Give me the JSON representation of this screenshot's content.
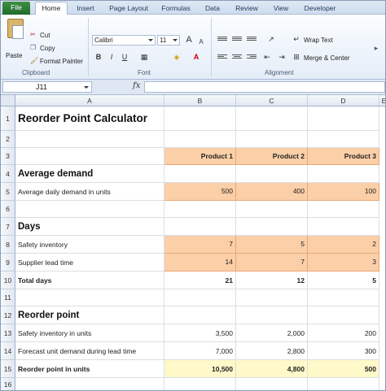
{
  "ribbon": {
    "tabs": [
      "File",
      "Home",
      "Insert",
      "Page Layout",
      "Formulas",
      "Data",
      "Review",
      "View",
      "Developer"
    ],
    "clipboard": {
      "paste": "Paste",
      "cut": "Cut",
      "copy": "Copy",
      "format_painter": "Format Painter",
      "label": "Clipboard"
    },
    "font": {
      "family": "Calibri",
      "size": "11",
      "bold": "B",
      "italic": "I",
      "underline": "U",
      "grow": "A",
      "shrink": "A",
      "label": "Font"
    },
    "alignment": {
      "wrap_text": "Wrap Text",
      "merge_center": "Merge & Center",
      "label": "Alignment"
    }
  },
  "formula_bar": {
    "name_box": "J11",
    "fx": "fx",
    "formula": ""
  },
  "columns": [
    "A",
    "B",
    "C",
    "D",
    "E"
  ],
  "rows": [
    "1",
    "2",
    "3",
    "4",
    "5",
    "6",
    "7",
    "8",
    "9",
    "10",
    "11",
    "12",
    "13",
    "14",
    "15",
    "16"
  ],
  "sheet": {
    "title": "Reorder Point Calculator",
    "headers": [
      "Product 1",
      "Product 2",
      "Product 3"
    ],
    "average_demand_heading": "Average demand",
    "avg_daily_demand": {
      "label": "Average daily demand in units",
      "values": [
        "500",
        "400",
        "100"
      ]
    },
    "days_heading": "Days",
    "safety_inventory": {
      "label": "Safety inventory",
      "values": [
        "7",
        "5",
        "2"
      ]
    },
    "supplier_lead_time": {
      "label": "Supplier lead time",
      "values": [
        "14",
        "7",
        "3"
      ]
    },
    "total_days": {
      "label": "Total days",
      "values": [
        "21",
        "12",
        "5"
      ]
    },
    "reorder_heading": "Reorder point",
    "safety_units": {
      "label": "Safety inventory in units",
      "values": [
        "3,500",
        "2,000",
        "200"
      ]
    },
    "forecast_units": {
      "label": "Forecast unit demand during lead time",
      "values": [
        "7,000",
        "2,800",
        "300"
      ]
    },
    "reorder_units": {
      "label": "Reorder point in units",
      "values": [
        "10,500",
        "4,800",
        "500"
      ]
    }
  }
}
